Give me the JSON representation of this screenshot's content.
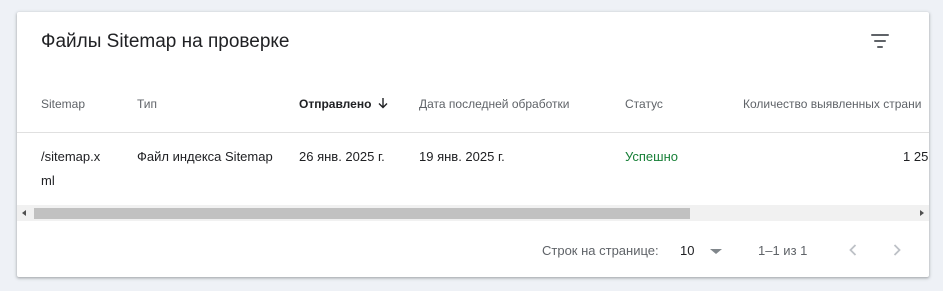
{
  "card": {
    "title": "Файлы Sitemap на проверке",
    "filter_icon": "filter-list-icon"
  },
  "table": {
    "columns": [
      {
        "label": "Sitemap",
        "sorted": false
      },
      {
        "label": "Тип",
        "sorted": false
      },
      {
        "label": "Отправлено",
        "sorted": true,
        "sort_direction": "descending",
        "sort_icon": "arrow-down-icon"
      },
      {
        "label": "Дата последней обработки",
        "sorted": false
      },
      {
        "label": "Статус",
        "sorted": false
      },
      {
        "label": "Количество выявленных страни",
        "sorted": false
      }
    ],
    "rows": [
      {
        "sitemap_line1": "/sitemap.x",
        "sitemap_line2": "ml",
        "type": "Файл индекса Sitemap",
        "submitted": "26 янв. 2025 г.",
        "last_processed": "19 янв. 2025 г.",
        "status": "Успешно",
        "discovered_pages": "1 25"
      }
    ],
    "horizontal_scroll_position": 0
  },
  "pagination": {
    "rows_per_page_label": "Строк на странице:",
    "rows_per_page_value": "10",
    "range_text": "1–1 из 1",
    "prev_icon": "chevron-left-icon",
    "next_icon": "chevron-right-icon"
  },
  "colors": {
    "status_success": "#188038",
    "disabled_icon": "#bdc1c6",
    "page_background": "#eef1f6"
  }
}
